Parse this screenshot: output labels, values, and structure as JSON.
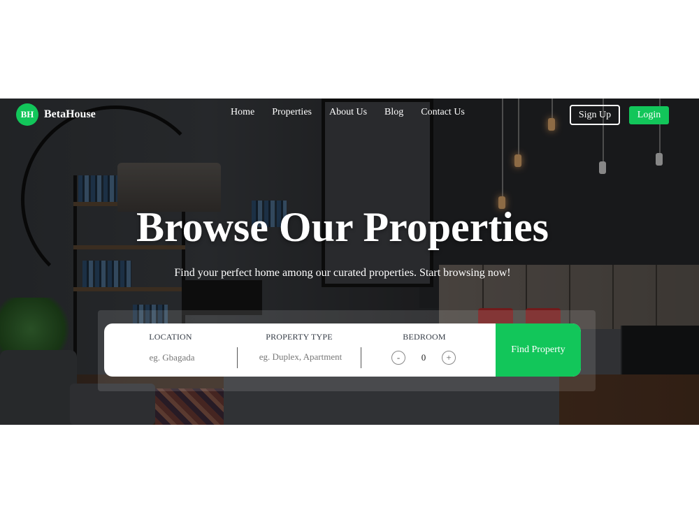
{
  "brand": {
    "initials": "BH",
    "name": "BetaHouse",
    "color": "#12c65a"
  },
  "nav": {
    "links": [
      "Home",
      "Properties",
      "About Us",
      "Blog",
      "Contact Us"
    ],
    "signup_label": "Sign Up",
    "login_label": "Login"
  },
  "hero": {
    "title": "Browse Our Properties",
    "subtitle": "Find your perfect home among our curated properties. Start browsing now!"
  },
  "search": {
    "location": {
      "label": "LOCATION",
      "placeholder": "eg. Gbagada",
      "value": ""
    },
    "property_type": {
      "label": "PROPERTY TYPE",
      "placeholder": "eg. Duplex, Apartment",
      "value": ""
    },
    "bedroom": {
      "label": "BEDROOM",
      "decrement": "-",
      "increment": "+",
      "value": "0"
    },
    "submit_label": "Find Property"
  }
}
